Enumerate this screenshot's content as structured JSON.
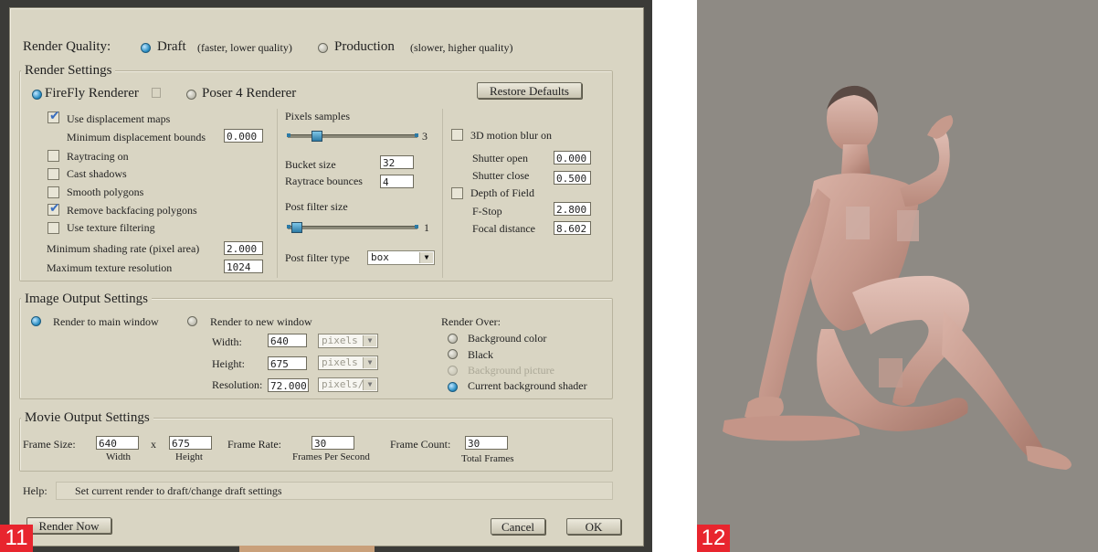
{
  "render_quality": {
    "label": "Render Quality:",
    "draft": "Draft",
    "draft_note": "(faster, lower quality)",
    "production": "Production",
    "production_note": "(slower, higher quality)",
    "selected": "draft"
  },
  "render_settings": {
    "title": "Render Settings",
    "firefly": "FireFly Renderer",
    "poser4": "Poser 4 Renderer",
    "restore_defaults": "Restore Defaults",
    "use_displacement": "Use displacement maps",
    "min_disp_bounds_label": "Minimum displacement bounds",
    "min_disp_bounds": "0.000",
    "raytracing": "Raytracing on",
    "cast_shadows": "Cast shadows",
    "smooth_polygons": "Smooth polygons",
    "remove_backfacing": "Remove backfacing polygons",
    "texture_filtering": "Use texture filtering",
    "min_shading_label": "Minimum shading rate (pixel area)",
    "min_shading": "2.000",
    "max_texture_label": "Maximum texture resolution",
    "max_texture": "1024",
    "pixel_samples_label": "Pixels samples",
    "pixel_samples_max": "3",
    "bucket_size_label": "Bucket size",
    "bucket_size": "32",
    "raytrace_bounces_label": "Raytrace bounces",
    "raytrace_bounces": "4",
    "post_filter_size_label": "Post filter size",
    "post_filter_size_max": "1",
    "post_filter_type_label": "Post filter type",
    "post_filter_type": "box",
    "motion_blur": "3D motion blur on",
    "shutter_open_label": "Shutter open",
    "shutter_open": "0.000",
    "shutter_close_label": "Shutter close",
    "shutter_close": "0.500",
    "depth_of_field": "Depth of Field",
    "fstop_label": "F-Stop",
    "fstop": "2.800",
    "focal_label": "Focal distance",
    "focal": "8.602"
  },
  "image_output": {
    "title": "Image Output Settings",
    "main_window": "Render to main window",
    "new_window": "Render to new window",
    "width_label": "Width:",
    "width": "640",
    "height_label": "Height:",
    "height": "675",
    "resolution_label": "Resolution:",
    "resolution": "72.000",
    "unit_pixels": "pixels",
    "unit_pixels_per": "pixels/",
    "render_over": "Render Over:",
    "bg_color": "Background color",
    "black": "Black",
    "bg_picture": "Background picture",
    "bg_shader": "Current background shader"
  },
  "movie_output": {
    "title": "Movie Output Settings",
    "frame_size_label": "Frame Size:",
    "frame_width": "640",
    "x_sep": "x",
    "frame_height": "675",
    "width_caption": "Width",
    "height_caption": "Height",
    "frame_rate_label": "Frame Rate:",
    "frame_rate": "30",
    "fps_caption": "Frames Per Second",
    "frame_count_label": "Frame Count:",
    "frame_count": "30",
    "total_caption": "Total Frames"
  },
  "help": {
    "label": "Help:",
    "text": "Set current render to draft/change draft settings"
  },
  "buttons": {
    "render_now": "Render Now",
    "cancel": "Cancel",
    "ok": "OK"
  },
  "badges": {
    "left": "11",
    "right": "12"
  },
  "colors": {
    "dialog_bg": "#d9d5c3",
    "viewport_bg": "#8e8a84",
    "badge": "#e8252e",
    "radio_on": "#2a8ec3"
  }
}
